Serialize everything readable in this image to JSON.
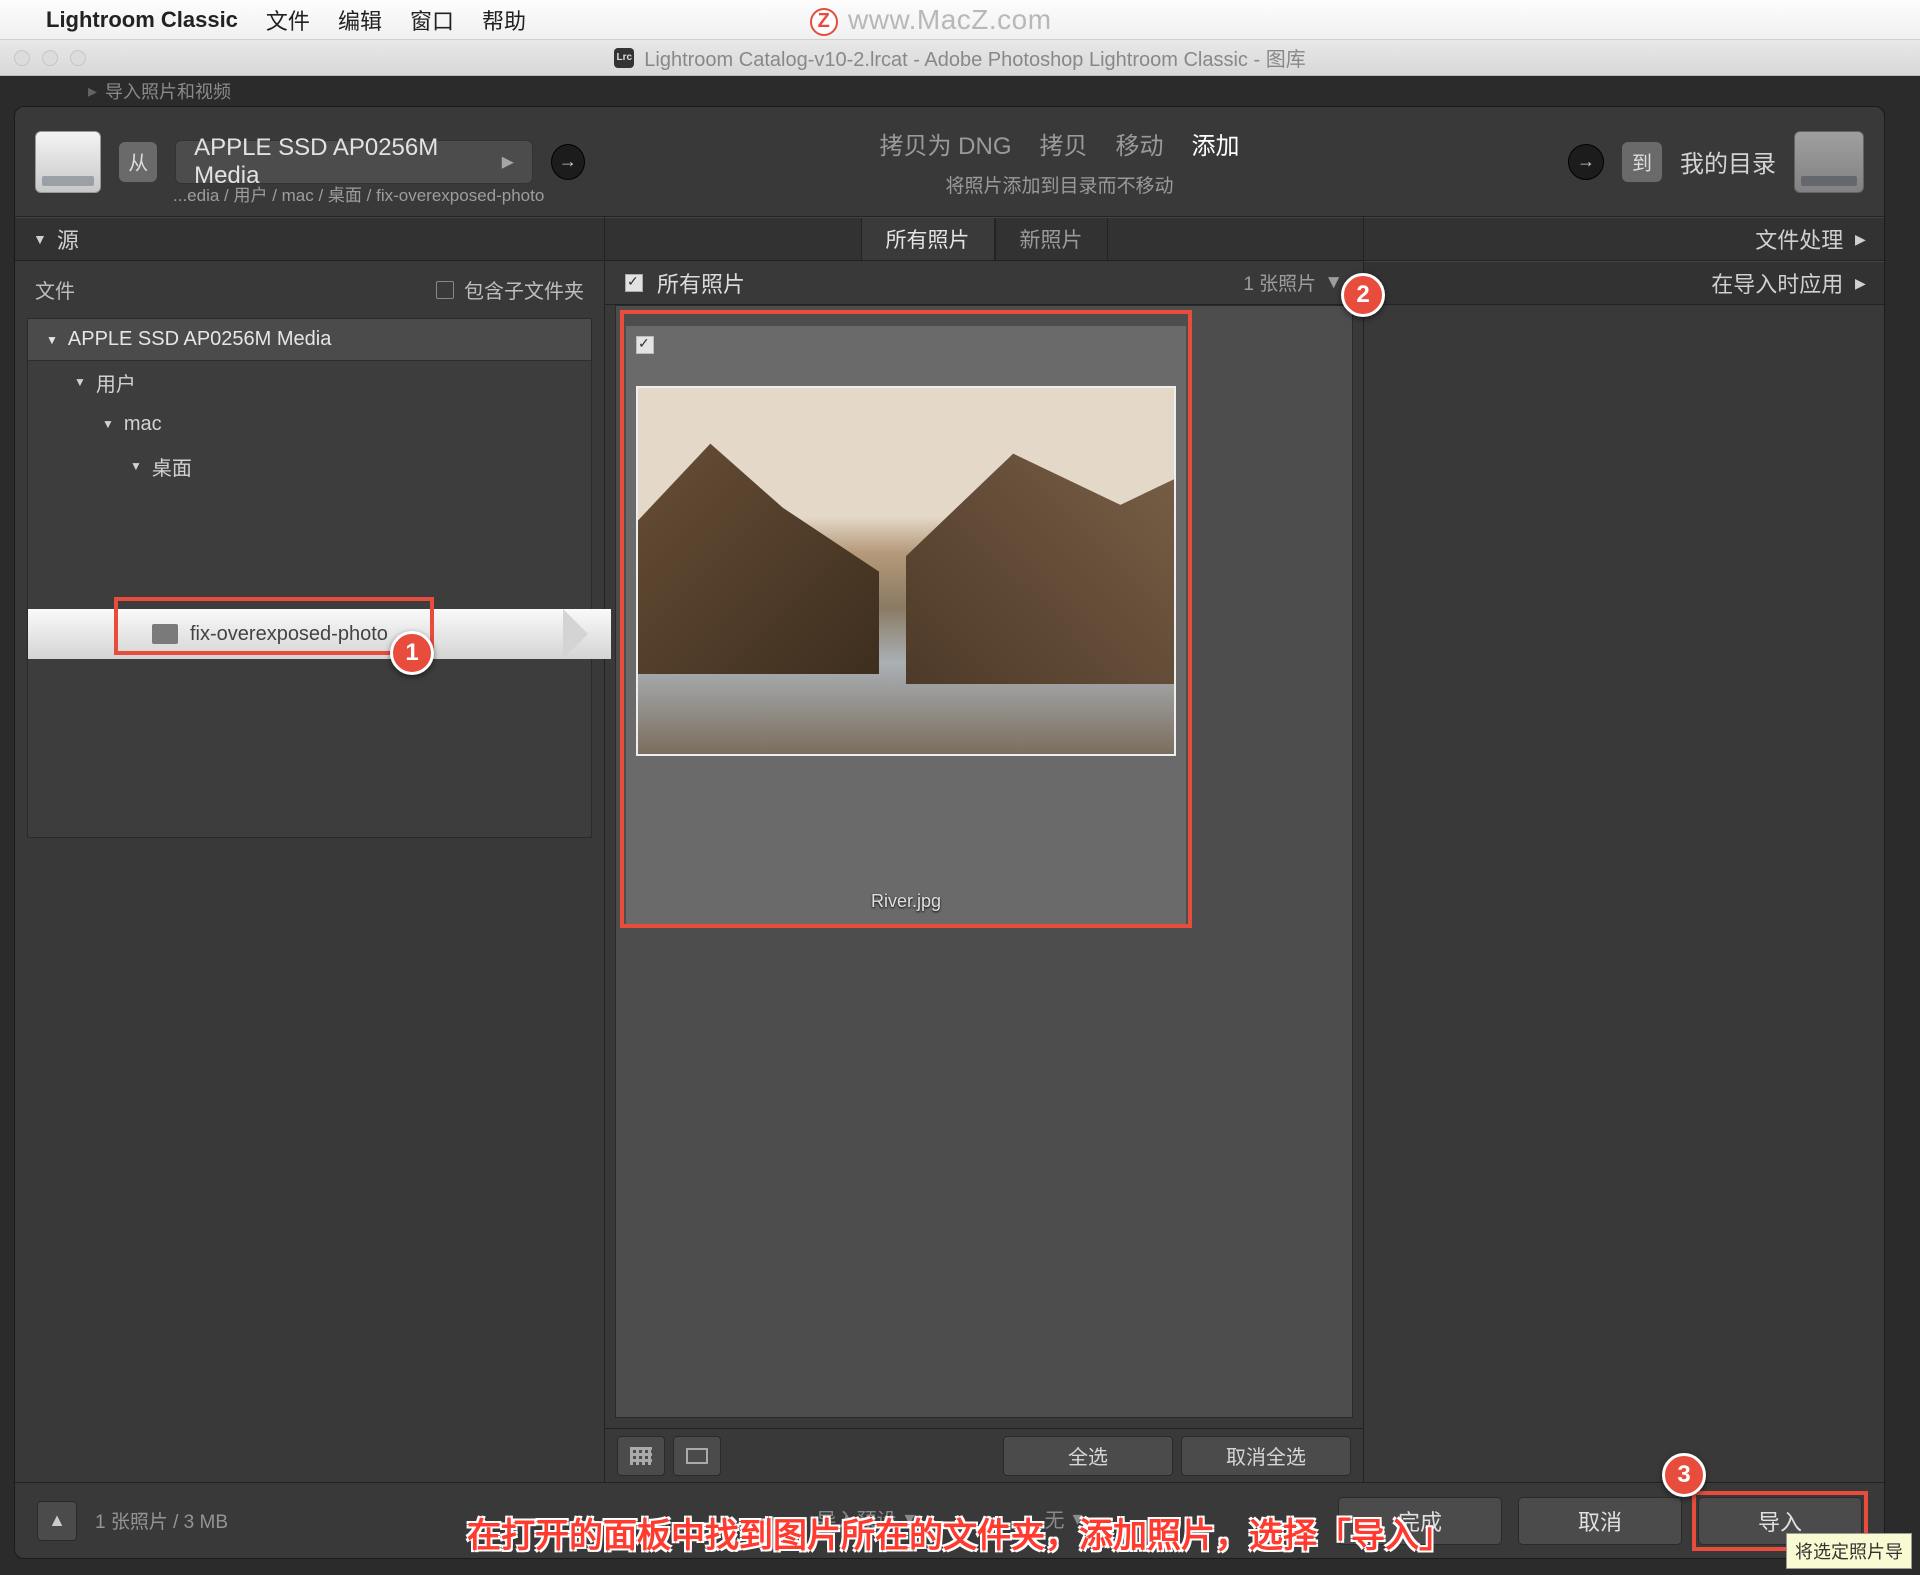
{
  "menubar": {
    "app": "Lightroom Classic",
    "file": "文件",
    "edit": "编辑",
    "window": "窗口",
    "help": "帮助"
  },
  "watermark": "www.MacZ.com",
  "window_title": "Lightroom Catalog-v10-2.lrcat - Adobe Photoshop Lightroom Classic - 图库",
  "hidden_strip": "导入照片和视频",
  "header": {
    "from_badge": "从",
    "source_select": "APPLE SSD AP0256M Media",
    "breadcrumb": "...edia / 用户 / mac / 桌面 / fix-overexposed-photo",
    "mode": {
      "copy_dng": "拷贝为 DNG",
      "copy": "拷贝",
      "move": "移动",
      "add": "添加"
    },
    "mode_sub": "将照片添加到目录而不移动",
    "to_badge": "到",
    "dest": "我的目录"
  },
  "left": {
    "panel_title": "源",
    "files_label": "文件",
    "include_sub": "包含子文件夹",
    "tree": {
      "root": "APPLE SSD AP0256M Media",
      "n1": "用户",
      "n2": "mac",
      "n3": "桌面",
      "selected": "fix-overexposed-photo"
    }
  },
  "center": {
    "tab_all": "所有照片",
    "tab_new": "新照片",
    "subbar": "所有照片",
    "count": "1 张照片",
    "thumb_name": "River.jpg",
    "select_all": "全选",
    "deselect_all": "取消全选"
  },
  "right": {
    "row1": "文件处理",
    "row2": "在导入时应用"
  },
  "footer": {
    "info": "1 张照片 / 3 MB",
    "preset": "导入预设",
    "none": "无",
    "done": "完成",
    "cancel": "取消",
    "import": "导入"
  },
  "tooltip": "将选定照片导",
  "caption": "在打开的面板中找到图片所在的文件夹，添加照片，选择「导入」",
  "markers": {
    "m1": "1",
    "m2": "2",
    "m3": "3"
  }
}
